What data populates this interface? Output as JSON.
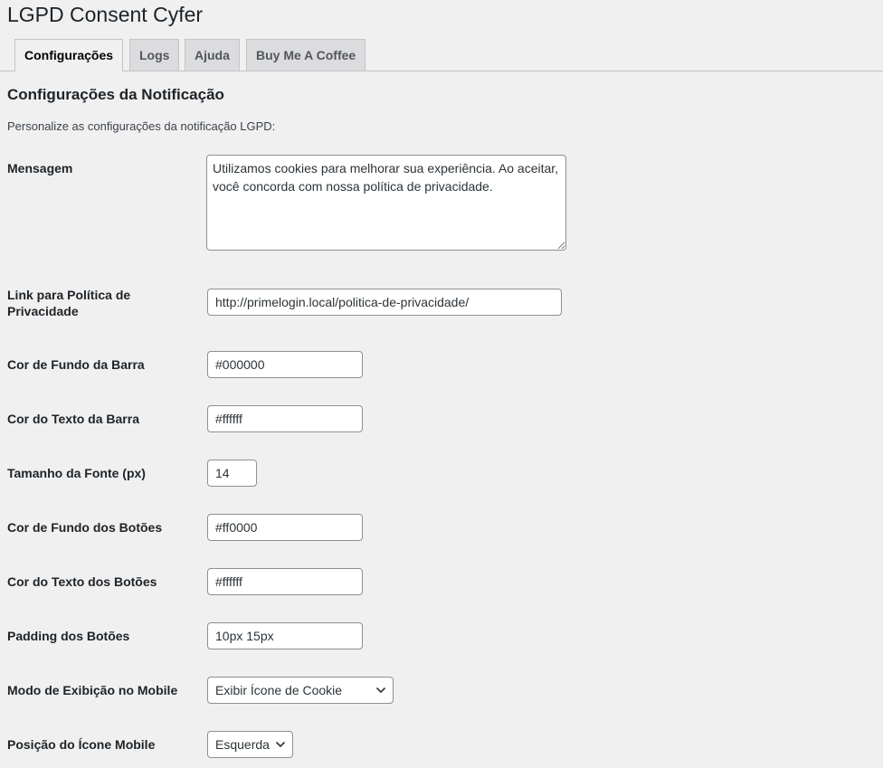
{
  "header": {
    "title": "LGPD Consent Cyfer"
  },
  "tabs": [
    {
      "label": "Configurações",
      "active": true
    },
    {
      "label": "Logs",
      "active": false
    },
    {
      "label": "Ajuda",
      "active": false
    },
    {
      "label": "Buy Me A Coffee",
      "active": false
    }
  ],
  "section": {
    "title": "Configurações da Notificação",
    "description": "Personalize as configurações da notificação LGPD:"
  },
  "fields": {
    "message": {
      "label": "Mensagem",
      "value": "Utilizamos cookies para melhorar sua experiência. Ao aceitar, você concorda com nossa política de privacidade."
    },
    "privacy_link": {
      "label": "Link para Política de Privacidade",
      "value": "http://primelogin.local/politica-de-privacidade/"
    },
    "bar_bg_color": {
      "label": "Cor de Fundo da Barra",
      "value": "#000000"
    },
    "bar_text_color": {
      "label": "Cor do Texto da Barra",
      "value": "#ffffff"
    },
    "font_size": {
      "label": "Tamanho da Fonte (px)",
      "value": "14"
    },
    "button_bg_color": {
      "label": "Cor de Fundo dos Botões",
      "value": "#ff0000"
    },
    "button_text_color": {
      "label": "Cor do Texto dos Botões",
      "value": "#ffffff"
    },
    "button_padding": {
      "label": "Padding dos Botões",
      "value": "10px 15px"
    },
    "mobile_display_mode": {
      "label": "Modo de Exibição no Mobile",
      "selected": "Exibir Ícone de Cookie"
    },
    "mobile_icon_position": {
      "label": "Posição do Ícone Mobile",
      "selected": "Esquerda"
    }
  },
  "colors": {
    "background": "#f0f0f1",
    "tab_inactive": "#dcdcde",
    "border": "#8c8f94"
  }
}
